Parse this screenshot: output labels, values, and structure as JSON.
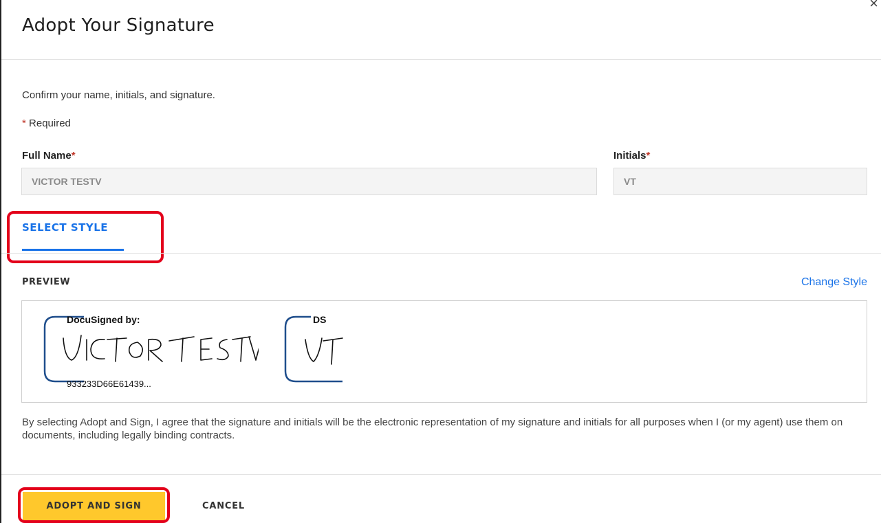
{
  "dialog": {
    "title": "Adopt Your Signature",
    "close_glyph": "×"
  },
  "intro": {
    "confirm_text": "Confirm your name, initials, and signature.",
    "required_star": "*",
    "required_text": "Required"
  },
  "form": {
    "full_name_label": "Full Name",
    "full_name_star": "*",
    "full_name_value": "VICTOR TESTV",
    "initials_label": "Initials",
    "initials_star": "*",
    "initials_value": "VT"
  },
  "tabs": [
    {
      "label": "SELECT STYLE",
      "active": true
    }
  ],
  "preview": {
    "label": "PREVIEW",
    "change_style": "Change Style",
    "signature_header": "DocuSigned by:",
    "signature_handwriting": "VICTOR TESTV",
    "signature_code": "933233D66E61439...",
    "initials_header": "DS",
    "initials_handwriting": "VT"
  },
  "legal_text": "By selecting Adopt and Sign, I agree that the signature and initials will be the electronic representation of my signature and initials for all purposes when I (or my agent) use them on documents, including legally binding contracts.",
  "buttons": {
    "adopt": "ADOPT AND SIGN",
    "cancel": "CANCEL"
  },
  "colors": {
    "accent_blue": "#1a73e8",
    "adopt_yellow": "#ffc82c",
    "highlight_red": "#e3001b",
    "docusign_bracket": "#1f4e8c"
  }
}
